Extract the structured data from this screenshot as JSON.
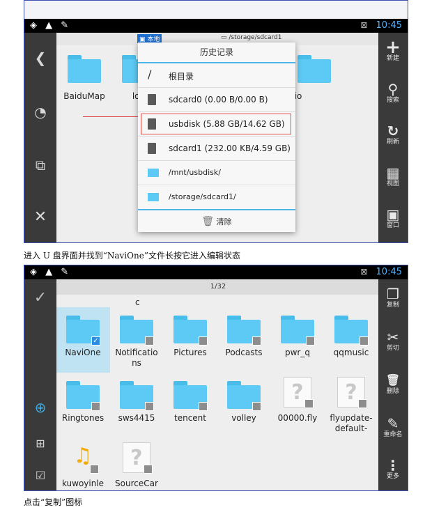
{
  "screen1": {
    "status": {
      "left_icons": "◈ ▲ ✎",
      "signal": "⊠",
      "time": "10:45"
    },
    "breadcrumb": {
      "local_tab": "本地",
      "path": "/storage/sdcard1"
    },
    "left_sidebar": [
      {
        "icon": "chevron-left-icon",
        "glyph": "❮"
      },
      {
        "icon": "history-icon",
        "glyph": "◔"
      },
      {
        "icon": "windows-icon",
        "glyph": "⧉"
      },
      {
        "icon": "close-icon",
        "glyph": "✕"
      }
    ],
    "right_sidebar": [
      {
        "icon": "plus-icon",
        "glyph": "+",
        "label": "新建"
      },
      {
        "icon": "search-icon",
        "glyph": "⚲",
        "label": "搜索"
      },
      {
        "icon": "refresh-icon",
        "glyph": "↻",
        "label": "刷新"
      },
      {
        "icon": "grid-icon",
        "glyph": "▦",
        "label": "视图"
      },
      {
        "icon": "window-icon",
        "glyph": "▣",
        "label": "窗口"
      }
    ],
    "folders": [
      {
        "label": "BaiduMap"
      },
      {
        "label": "log"
      },
      {
        "label": "dio"
      }
    ],
    "dialog": {
      "title": "历史记录",
      "items": [
        {
          "icon": "slash-icon",
          "text": "根目录"
        },
        {
          "icon": "sdcard-icon",
          "text": "sdcard0 (0.00 B/0.00 B)"
        },
        {
          "icon": "sdcard-icon",
          "text": "usbdisk (5.88 GB/14.62 GB)"
        },
        {
          "icon": "sdcard-icon",
          "text": "sdcard1 (232.00 KB/4.59 GB)"
        },
        {
          "icon": "folder-icon",
          "text": "/mnt/usbdisk/"
        },
        {
          "icon": "folder-icon",
          "text": "/storage/sdcard1/"
        }
      ],
      "clear_label": "清除"
    }
  },
  "caption1": "进入 U 盘界面并找到“NaviOne”文件长按它进入编辑状态",
  "screen2": {
    "status": {
      "left_icons": "◈ ▲ ✎",
      "signal": "⊠",
      "time": "10:45"
    },
    "counter": "1/32",
    "partial_label": "c",
    "left_sidebar": [
      {
        "icon": "checkmark-icon",
        "glyph": "✓"
      },
      {
        "icon": "globe-search-icon",
        "glyph": "⊕"
      },
      {
        "icon": "select-range-icon",
        "glyph": "⊞"
      },
      {
        "icon": "select-all-icon",
        "glyph": "☑"
      }
    ],
    "right_sidebar": [
      {
        "icon": "copy-icon",
        "glyph": "❐",
        "label": "复制"
      },
      {
        "icon": "scissors-icon",
        "glyph": "✂",
        "label": "剪切"
      },
      {
        "icon": "trash-icon",
        "glyph": "🗑",
        "label": "删除"
      },
      {
        "icon": "rename-icon",
        "glyph": "✎",
        "label": "重命名"
      },
      {
        "icon": "more-icon",
        "glyph": "⋮",
        "label": "更多"
      }
    ],
    "grid": [
      {
        "label": "NaviOne",
        "label2": "",
        "type": "folder",
        "checked": true
      },
      {
        "label": "Notificatio",
        "label2": "ns",
        "type": "folder",
        "checked": false
      },
      {
        "label": "Pictures",
        "label2": "",
        "type": "folder",
        "checked": false
      },
      {
        "label": "Podcasts",
        "label2": "",
        "type": "folder",
        "checked": false
      },
      {
        "label": "pwr_q",
        "label2": "",
        "type": "folder",
        "checked": false
      },
      {
        "label": "qqmusic",
        "label2": "",
        "type": "folder",
        "checked": false
      },
      {
        "label": "Ringtones",
        "label2": "",
        "type": "folder",
        "checked": false
      },
      {
        "label": "sws4415",
        "label2": "",
        "type": "folder",
        "checked": false
      },
      {
        "label": "tencent",
        "label2": "",
        "type": "folder",
        "checked": false
      },
      {
        "label": "volley",
        "label2": "",
        "type": "folder",
        "checked": false
      },
      {
        "label": "00000.fly",
        "label2": "",
        "type": "file",
        "checked": false
      },
      {
        "label": "flyupdate-",
        "label2": "default-",
        "type": "file",
        "checked": false
      },
      {
        "label": "kuwoyinle",
        "label2": "",
        "type": "app",
        "checked": false
      },
      {
        "label": "SourceCar",
        "label2": "",
        "type": "file",
        "checked": false
      }
    ]
  },
  "caption2": "点击“复制”图标",
  "colors": {
    "folder": "#5ccaf4",
    "accent": "#4db6e8",
    "highlight": "#e24a4a",
    "time": "#4fb3ff"
  }
}
